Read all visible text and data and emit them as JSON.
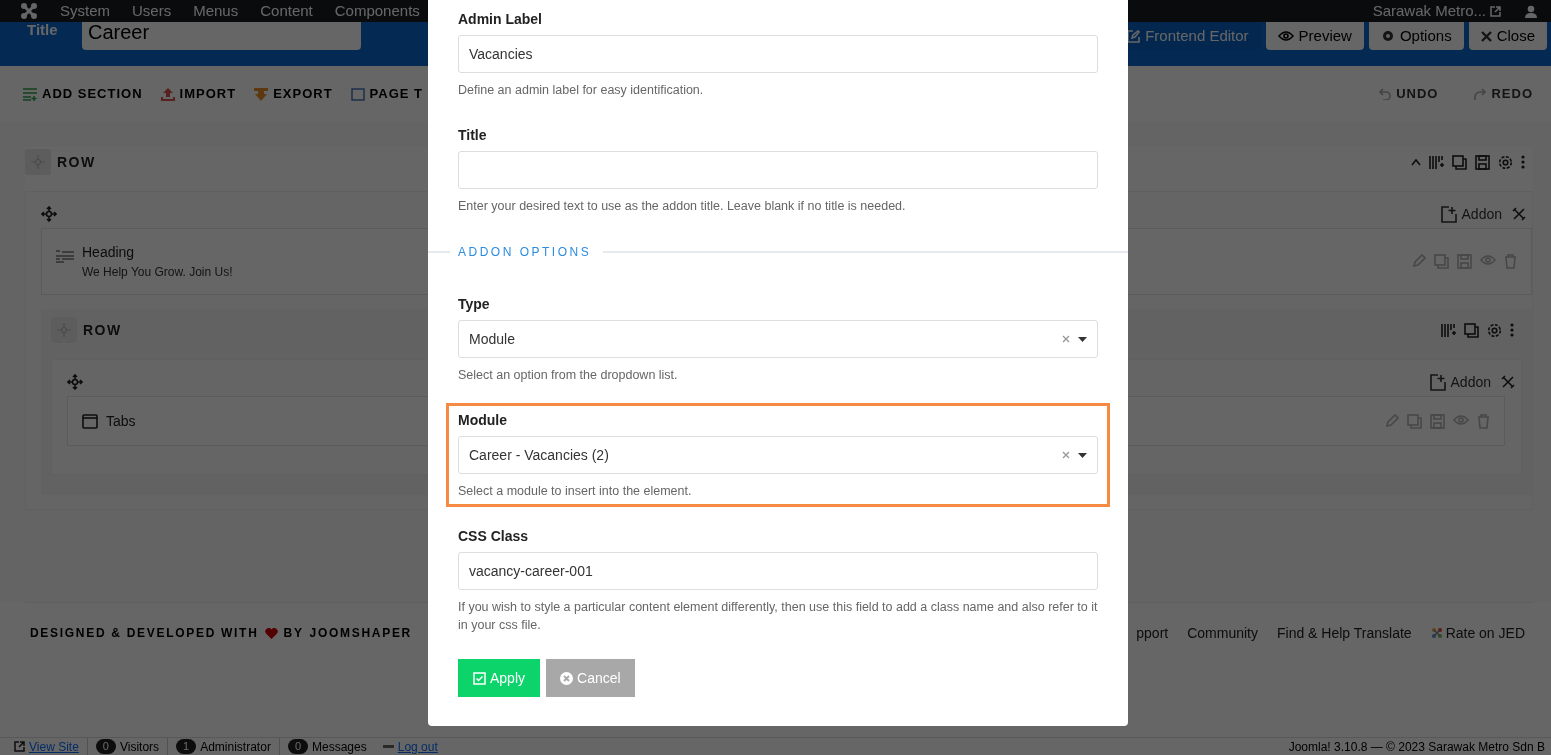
{
  "top_nav": {
    "menu": [
      "System",
      "Users",
      "Menus",
      "Content",
      "Components"
    ],
    "site_link": "Sarawak Metro..."
  },
  "title_bar": {
    "label": "Title",
    "value": "Career",
    "buttons": [
      {
        "kind": "primary",
        "label": "Frontend Editor"
      },
      {
        "kind": "preview",
        "label": "Preview"
      },
      {
        "kind": "options",
        "label": "Options"
      },
      {
        "kind": "close",
        "label": "Close"
      }
    ]
  },
  "toolbar": {
    "left": [
      {
        "kind": "add",
        "label": "ADD SECTION"
      },
      {
        "kind": "import",
        "label": "IMPORT"
      },
      {
        "kind": "export",
        "label": "EXPORT"
      },
      {
        "kind": "page",
        "label": "PAGE T"
      }
    ],
    "right": [
      {
        "kind": "undo",
        "label": "UNDO"
      },
      {
        "kind": "redo",
        "label": "REDO"
      }
    ]
  },
  "builder": {
    "label": "ROW",
    "column": {
      "addon_button": "Addon",
      "addons": [
        {
          "kind": "heading",
          "name": "Heading",
          "subtitle": "We Help You Grow. Join Us!"
        },
        {
          "kind": "row",
          "label": "ROW",
          "column": {
            "addon_button": "Addon",
            "addons": [
              {
                "kind": "tabs",
                "name": "Tabs"
              }
            ]
          }
        }
      ]
    }
  },
  "footer": {
    "credit": "DESIGNED & DEVELOPED WITH",
    "credit_by": "BY",
    "credit_link": "JOOMSHAPER",
    "links": [
      {
        "kind": "plain",
        "label": "pport"
      },
      {
        "kind": "plain",
        "label": "Community"
      },
      {
        "kind": "plain",
        "label": "Find & Help Translate"
      },
      {
        "kind": "jed",
        "label": "Rate on JED"
      }
    ]
  },
  "status_bar": {
    "items": [
      {
        "kind": "link",
        "label": "View Site"
      },
      {
        "kind": "count",
        "count": "0",
        "label": "Visitors"
      },
      {
        "kind": "count",
        "count": "1",
        "label": "Administrator"
      },
      {
        "kind": "count",
        "count": "0",
        "label": "Messages"
      },
      {
        "kind": "logout",
        "label": "Log out"
      }
    ],
    "version": "Joomla! 3.10.8 — © 2023 Sarawak Metro Sdn B"
  },
  "modal": {
    "fields": [
      {
        "kind": "text",
        "label": "Admin Label",
        "value": "Vacancies",
        "help": "Define an admin label for easy identification.",
        "highlighted": false
      },
      {
        "kind": "text",
        "label": "Title",
        "help": "Enter your desired text to use as the addon title. Leave blank if no title is needed.",
        "highlighted": false
      },
      {
        "kind": "section",
        "label": "ADDON OPTIONS"
      },
      {
        "kind": "select",
        "label": "Type",
        "value": "Module",
        "help": "Select an option from the dropdown list.",
        "highlighted": false
      },
      {
        "kind": "select",
        "label": "Module",
        "value": "Career - Vacancies (2)",
        "help": "Select a module to insert into the element.",
        "highlighted": true
      },
      {
        "kind": "text",
        "label": "CSS Class",
        "value": "vacancy-career-001",
        "help": "If you wish to style a particular content element differently, then use this field to add a class name and also refer to it in your css file.",
        "highlighted": false
      }
    ],
    "buttons": [
      {
        "kind": "apply",
        "label": "Apply"
      },
      {
        "kind": "cancel",
        "label": "Cancel"
      }
    ]
  }
}
